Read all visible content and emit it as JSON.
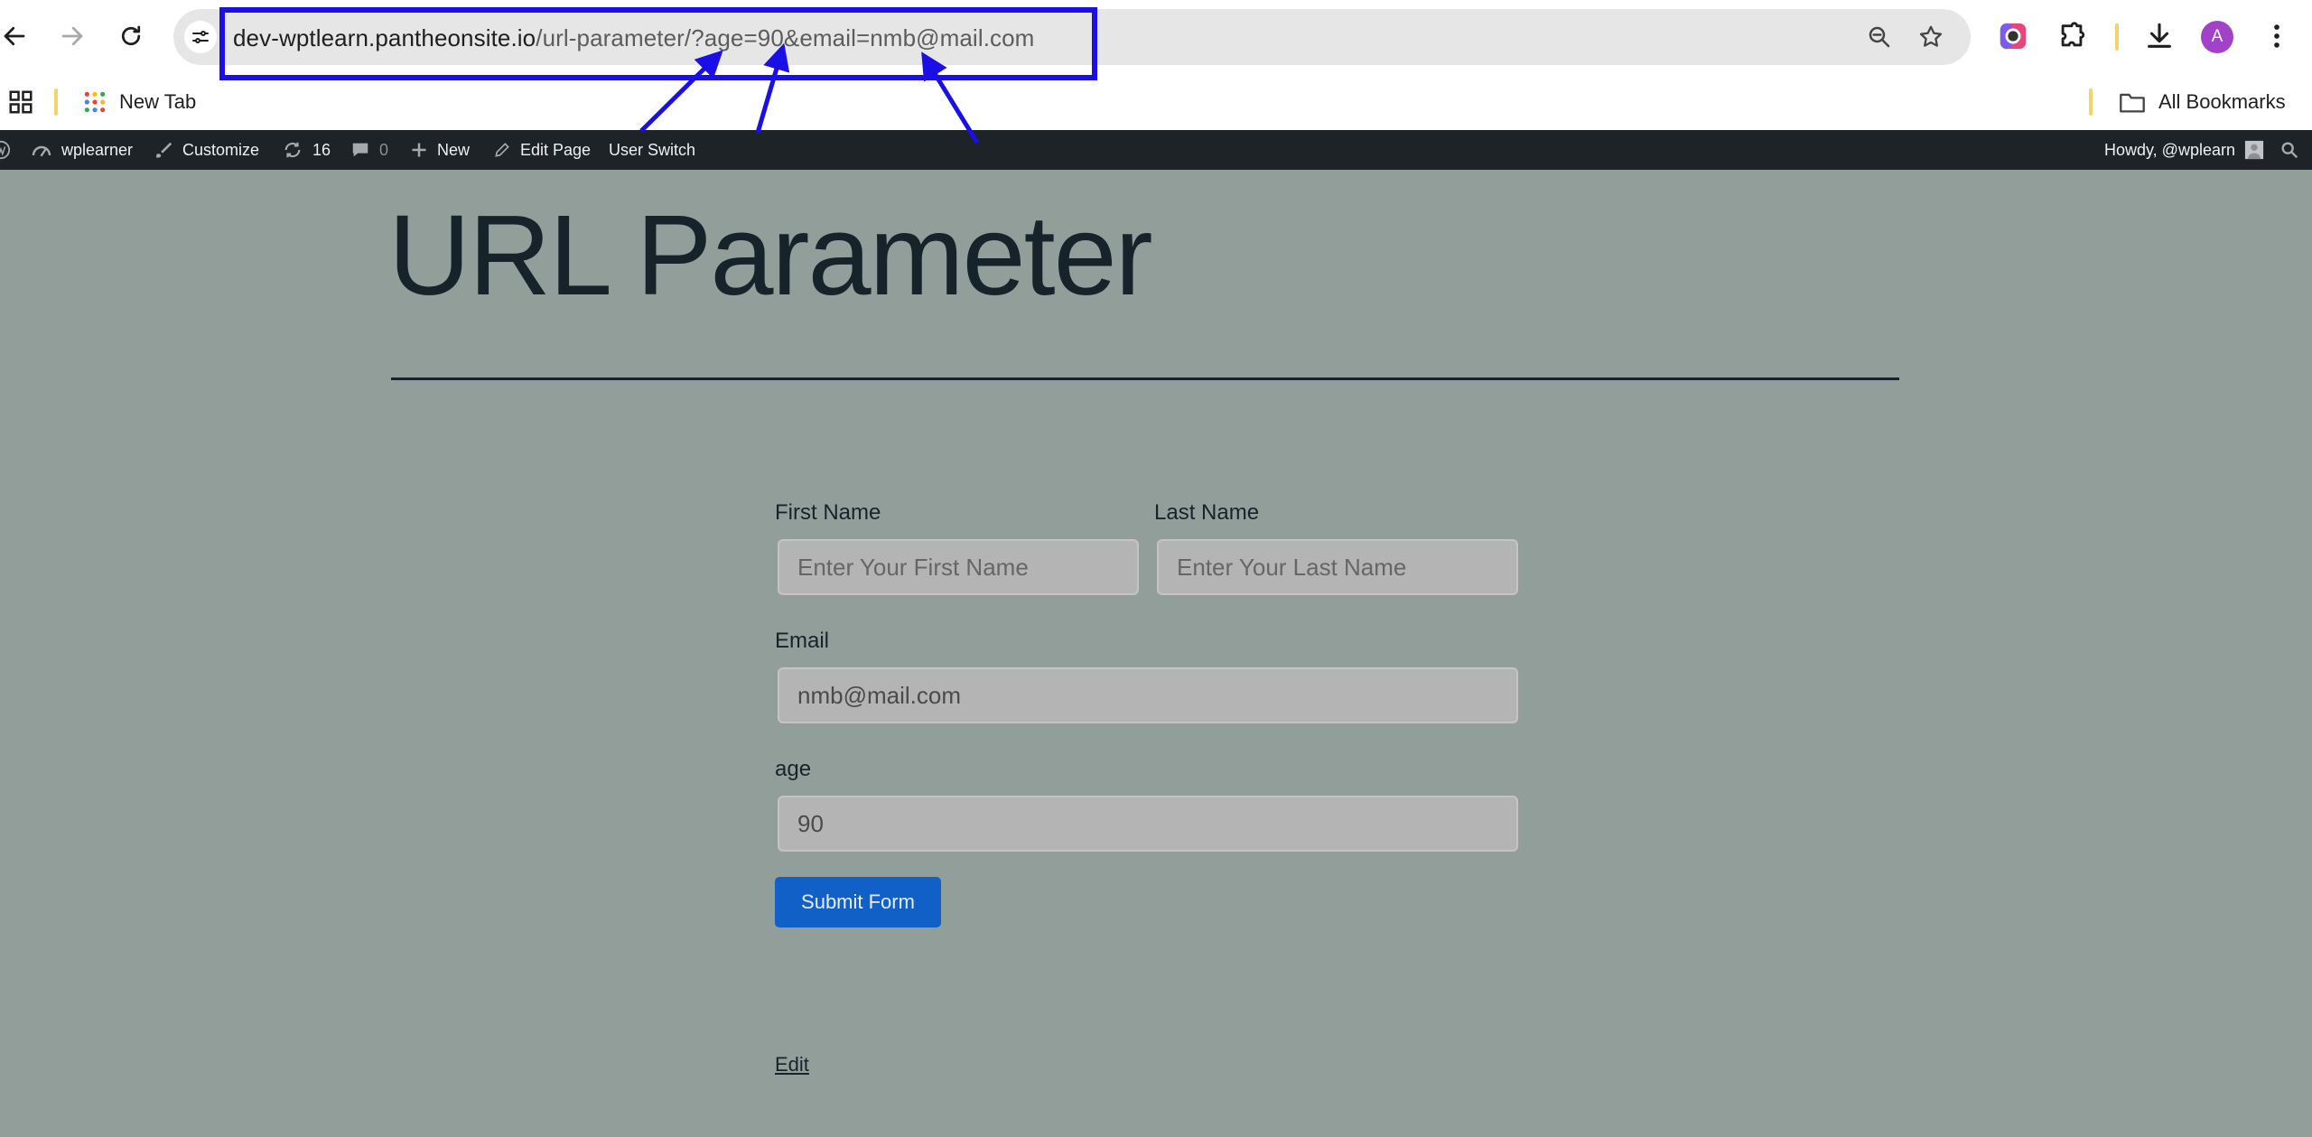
{
  "browser": {
    "url": {
      "host": "dev-wptlearn.pantheonsite.io",
      "path": "/url-parameter/?age=90&email=nmb@mail.com"
    },
    "profile_initial": "A",
    "icons": {
      "back": "arrow-left-icon",
      "forward": "arrow-right-icon",
      "reload": "reload-icon",
      "site_info": "tune-icon",
      "zoom": "zoom-out-icon",
      "bookmark": "star-icon",
      "extension_color": "color-picker-extension-icon",
      "extensions": "puzzle-icon",
      "downloads": "download-icon",
      "menu": "kebab-menu-icon"
    }
  },
  "bookmarks_bar": {
    "items": [
      {
        "label": "New Tab"
      }
    ],
    "all_bookmarks": "All Bookmarks"
  },
  "admin_bar": {
    "site_name": "wplearner",
    "customize": "Customize",
    "updates_count": "16",
    "comments_count": "0",
    "new": "New",
    "edit_page": "Edit Page",
    "user_switch": "User Switch",
    "howdy": "Howdy, @wplearn"
  },
  "page": {
    "title": "URL Parameter",
    "form": {
      "first_name_label": "First Name",
      "first_name_placeholder": "Enter Your First Name",
      "last_name_label": "Last Name",
      "last_name_placeholder": "Enter Your Last Name",
      "email_label": "Email",
      "email_value": "nmb@mail.com",
      "age_label": "age",
      "age_value": "90",
      "submit_label": "Submit Form"
    },
    "edit_link": "Edit"
  },
  "colors": {
    "annotation": "#1a0fe6",
    "page_background": "#929e99",
    "admin_bar": "#1d2327",
    "submit_button": "#1060c7",
    "heading_text": "#17232b"
  }
}
